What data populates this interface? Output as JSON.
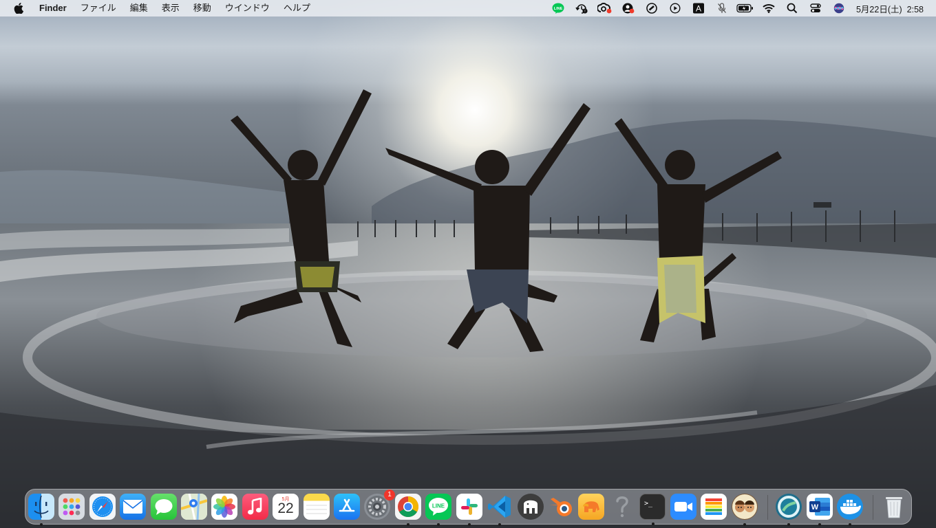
{
  "menubar": {
    "app_name": "Finder",
    "menus": [
      "ファイル",
      "編集",
      "表示",
      "移動",
      "ウインドウ",
      "ヘルプ"
    ],
    "status_icons": [
      "line-icon",
      "time-machine-icon",
      "creative-cloud-icon",
      "user-activity-icon",
      "record-icon",
      "play-icon",
      "input-source-icon",
      "mic-mute-icon",
      "battery-icon",
      "wifi-icon",
      "spotlight-icon",
      "control-center-icon",
      "siri-icon"
    ],
    "input_source_label": "A",
    "date": "5月22日(土)",
    "time": "2:58",
    "accent_colors": {
      "line": "#06c755",
      "battery": "#34c759"
    }
  },
  "dock": {
    "apps": [
      {
        "name": "Finder",
        "icon": "finder-icon",
        "running": true
      },
      {
        "name": "Launchpad",
        "icon": "launchpad-icon",
        "running": false
      },
      {
        "name": "Safari",
        "icon": "safari-icon",
        "running": false
      },
      {
        "name": "Mail",
        "icon": "mail-icon",
        "running": false
      },
      {
        "name": "Messages",
        "icon": "messages-icon",
        "running": false
      },
      {
        "name": "Maps",
        "icon": "maps-icon",
        "running": false
      },
      {
        "name": "Photos",
        "icon": "photos-icon",
        "running": false
      },
      {
        "name": "Music",
        "icon": "music-icon",
        "running": false
      },
      {
        "name": "Calendar",
        "icon": "calendar-icon",
        "running": false
      },
      {
        "name": "Notes",
        "icon": "notes-icon",
        "running": false
      },
      {
        "name": "App Store",
        "icon": "app-store-icon",
        "running": false
      },
      {
        "name": "System Preferences",
        "icon": "system-preferences-icon",
        "running": false
      },
      {
        "name": "Google Chrome",
        "icon": "chrome-icon",
        "running": true
      },
      {
        "name": "LINE",
        "icon": "line-icon",
        "running": true
      },
      {
        "name": "Slack",
        "icon": "slack-icon",
        "running": true
      },
      {
        "name": "Visual Studio Code",
        "icon": "vscode-icon",
        "running": true
      },
      {
        "name": "Mammoth",
        "icon": "mammoth-icon",
        "running": false
      },
      {
        "name": "Blender",
        "icon": "blender-icon",
        "running": false
      },
      {
        "name": "TablePlus",
        "icon": "elephant-icon",
        "running": false
      },
      {
        "name": "Unknown",
        "icon": "question-mark-icon",
        "running": false
      },
      {
        "name": "Terminal",
        "icon": "terminal-icon",
        "running": true
      },
      {
        "name": "Zoom",
        "icon": "zoom-icon",
        "running": false
      },
      {
        "name": "Instastats",
        "icon": "bar-chart-icon",
        "running": false
      },
      {
        "name": "Avatar App",
        "icon": "avatar-icon",
        "running": true
      },
      {
        "name": "Pin App",
        "icon": "globe-pin-icon",
        "running": true
      },
      {
        "name": "Microsoft Word",
        "icon": "word-icon",
        "running": true
      },
      {
        "name": "Docker",
        "icon": "docker-icon",
        "running": true
      },
      {
        "name": "Trash",
        "icon": "trash-icon",
        "running": false
      }
    ],
    "system_preferences_badge": "1",
    "calendar_month": "5月",
    "calendar_day": "22",
    "terminal_prompt": ">_",
    "word_letter": "W",
    "line_text": "LINE"
  }
}
